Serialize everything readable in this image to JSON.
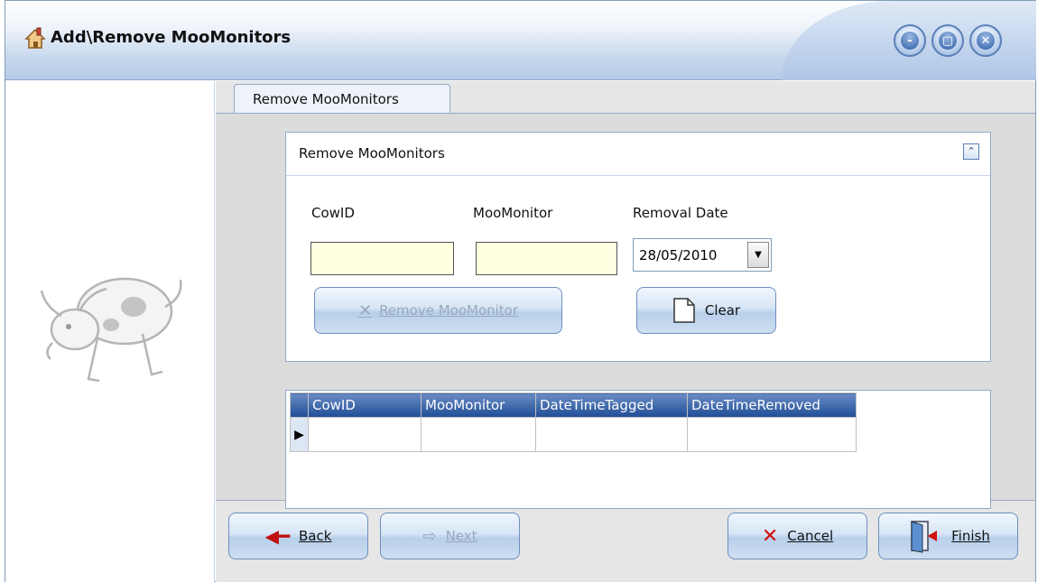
{
  "window": {
    "title": "Add\\Remove MooMonitors",
    "controls": {
      "minimize": "-",
      "maximize": "▢",
      "close": "✕"
    }
  },
  "tabs": [
    {
      "label": "Remove MooMonitors",
      "active": true
    }
  ],
  "group": {
    "title": "Remove MooMonitors",
    "collapse_icon": "double-chevron-up-icon"
  },
  "fields": {
    "cowid_label": "CowID",
    "cowid_value": "",
    "moomonitor_label": "MooMonitor",
    "moomonitor_value": "",
    "removal_date_label": "Removal Date",
    "removal_date_value": "28/05/2010"
  },
  "buttons": {
    "remove": "Remove MooMonitor",
    "clear": "Clear",
    "back": "Back",
    "next": "Next",
    "cancel": "Cancel",
    "finish": "Finish"
  },
  "grid": {
    "columns": [
      "CowID",
      "MooMonitor",
      "DateTimeTagged",
      "DateTimeRemoved"
    ],
    "rows": [
      [
        "",
        "",
        "",
        ""
      ]
    ]
  },
  "colors": {
    "input_yellow": "#ffffe1",
    "grid_header": "#1f4d96",
    "cancel_red": "#d01010"
  }
}
